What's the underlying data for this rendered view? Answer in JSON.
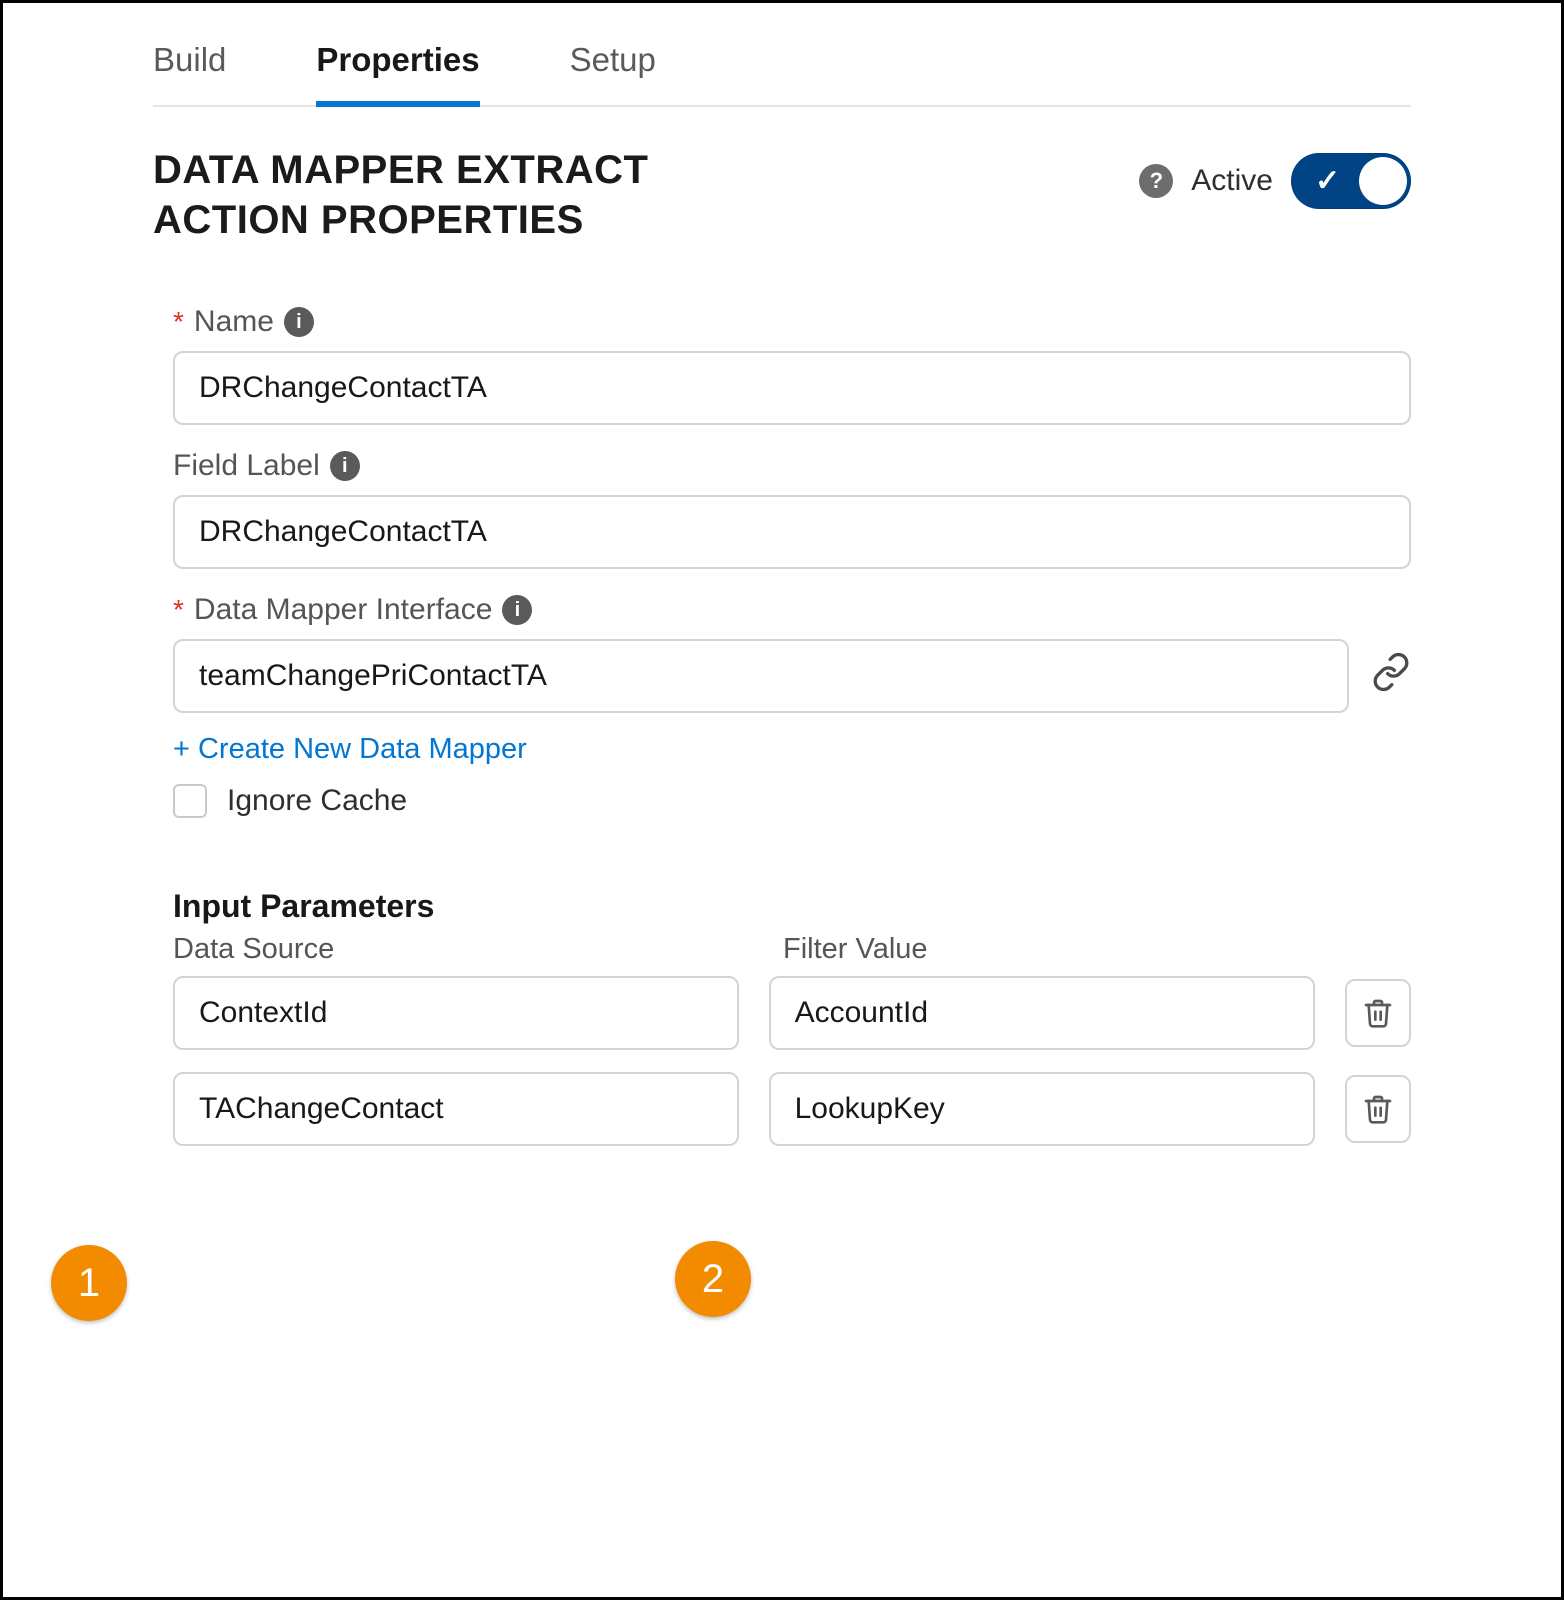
{
  "tabs": {
    "build": "Build",
    "properties": "Properties",
    "setup": "Setup"
  },
  "page_title": "DATA MAPPER EXTRACT ACTION PROPERTIES",
  "active": {
    "label": "Active",
    "on": true
  },
  "fields": {
    "name": {
      "label": "Name",
      "required": true,
      "value": "DRChangeContactTA"
    },
    "field_label": {
      "label": "Field Label",
      "required": false,
      "value": "DRChangeContactTA"
    },
    "dm_interface": {
      "label": "Data Mapper Interface",
      "required": true,
      "value": "teamChangePriContactTA"
    },
    "create_link": "+ Create New Data Mapper",
    "ignore_cache": {
      "label": "Ignore Cache",
      "checked": false
    }
  },
  "input_params": {
    "section_title": "Input Parameters",
    "col1": "Data Source",
    "col2": "Filter Value",
    "rows": [
      {
        "source": "ContextId",
        "filter": "AccountId"
      },
      {
        "source": "TAChangeContact",
        "filter": "LookupKey"
      }
    ]
  },
  "callouts": {
    "one": "1",
    "two": "2"
  }
}
